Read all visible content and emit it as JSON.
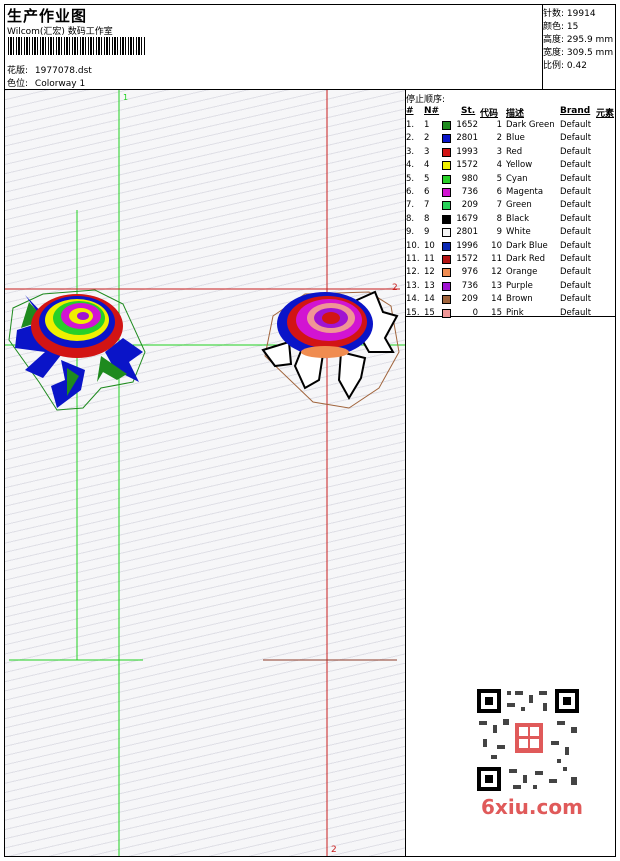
{
  "header": {
    "title": "生产作业图",
    "subtitle": "Wilcom(汇宏) 数码工作室",
    "design_label": "花版:",
    "design_value": "1977078.dst",
    "colorway_label": "色位:",
    "colorway_value": "Colorway 1"
  },
  "stats": [
    {
      "label": "针数:",
      "value": "19914"
    },
    {
      "label": "颜色:",
      "value": "15"
    },
    {
      "label": "高度:",
      "value": "295.9 mm"
    },
    {
      "label": "宽度:",
      "value": "309.5 mm"
    },
    {
      "label": "比例:",
      "value": "0.42"
    }
  ],
  "canvas": {
    "marker_top_green": "1",
    "marker_top_red": "2",
    "marker_right_red": "2",
    "marker_bottom_red": "2"
  },
  "table": {
    "caption": "停止顺序:",
    "columns": [
      "#",
      "N#",
      "St.",
      "代码",
      "描述",
      "Brand",
      "元素"
    ],
    "rows": [
      {
        "idx": "1.",
        "n": "1",
        "color": "#1e8a1e",
        "st": "1652",
        "code": "1",
        "desc": "Dark Green",
        "brand": "Default"
      },
      {
        "idx": "2.",
        "n": "2",
        "color": "#0a14c8",
        "st": "2801",
        "code": "2",
        "desc": "Blue",
        "brand": "Default"
      },
      {
        "idx": "3.",
        "n": "3",
        "color": "#d21414",
        "st": "1993",
        "code": "3",
        "desc": "Red",
        "brand": "Default"
      },
      {
        "idx": "4.",
        "n": "4",
        "color": "#f0f000",
        "st": "1572",
        "code": "4",
        "desc": "Yellow",
        "brand": "Default"
      },
      {
        "idx": "5.",
        "n": "5",
        "color": "#28d028",
        "st": "980",
        "code": "5",
        "desc": "Cyan",
        "brand": "Default"
      },
      {
        "idx": "6.",
        "n": "6",
        "color": "#d214d2",
        "st": "736",
        "code": "6",
        "desc": "Magenta",
        "brand": "Default"
      },
      {
        "idx": "7.",
        "n": "7",
        "color": "#28d25a",
        "st": "209",
        "code": "7",
        "desc": "Green",
        "brand": "Default"
      },
      {
        "idx": "8.",
        "n": "8",
        "color": "#000000",
        "st": "1679",
        "code": "8",
        "desc": "Black",
        "brand": "Default"
      },
      {
        "idx": "9.",
        "n": "9",
        "color": "#f4f4f4",
        "st": "2801",
        "code": "9",
        "desc": "White",
        "brand": "Default"
      },
      {
        "idx": "10.",
        "n": "10",
        "color": "#0a28b4",
        "st": "1996",
        "code": "10",
        "desc": "Dark Blue",
        "brand": "Default"
      },
      {
        "idx": "11.",
        "n": "11",
        "color": "#b41414",
        "st": "1572",
        "code": "11",
        "desc": "Dark Red",
        "brand": "Default"
      },
      {
        "idx": "12.",
        "n": "12",
        "color": "#f08c50",
        "st": "976",
        "code": "12",
        "desc": "Orange",
        "brand": "Default"
      },
      {
        "idx": "13.",
        "n": "13",
        "color": "#a014d2",
        "st": "736",
        "code": "13",
        "desc": "Purple",
        "brand": "Default"
      },
      {
        "idx": "14.",
        "n": "14",
        "color": "#a0643c",
        "st": "209",
        "code": "14",
        "desc": "Brown",
        "brand": "Default"
      },
      {
        "idx": "15.",
        "n": "15",
        "color": "#f09696",
        "st": "0",
        "code": "15",
        "desc": "Pink",
        "brand": "Default"
      }
    ]
  },
  "watermark": "6xiu.com"
}
